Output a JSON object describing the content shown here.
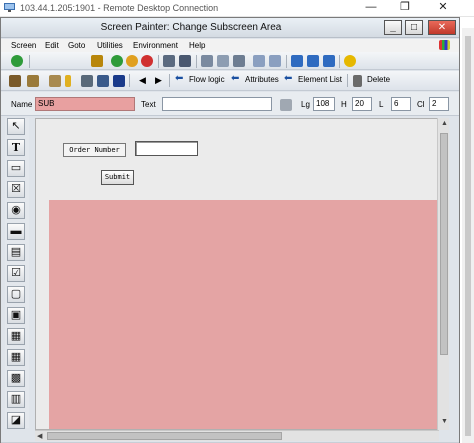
{
  "rdp": {
    "title": "103.44.1.205:1901 - Remote Desktop Connection",
    "minimize": "—",
    "restore": "❐",
    "close": "✕"
  },
  "window": {
    "title": "Screen Painter:  Change Subscreen Area",
    "minimize": "_",
    "maximize": "□",
    "close": "✕"
  },
  "menu": [
    "Screen",
    "Edit",
    "Goto",
    "Utilities",
    "Environment",
    "Help"
  ],
  "toolbar2": {
    "flow_logic": "Flow logic",
    "attributes": "Attributes",
    "element_list": "Element List",
    "delete": "Delete"
  },
  "attributes": {
    "name_label": "Name",
    "name_value": "SUB",
    "text_label": "Text",
    "text_value": "",
    "lg_label": "Lg",
    "lg_value": "108",
    "h_label": "H",
    "h_value": "20",
    "l_label": "L",
    "l_value": "6",
    "cl_label": "Cl",
    "cl_value": "2"
  },
  "canvas": {
    "order_label": "Order Number",
    "order_value": "",
    "submit_label": "Submit"
  },
  "colors": {
    "subscreen": "#e4a4a4",
    "name_field": "#e8a0a0"
  }
}
